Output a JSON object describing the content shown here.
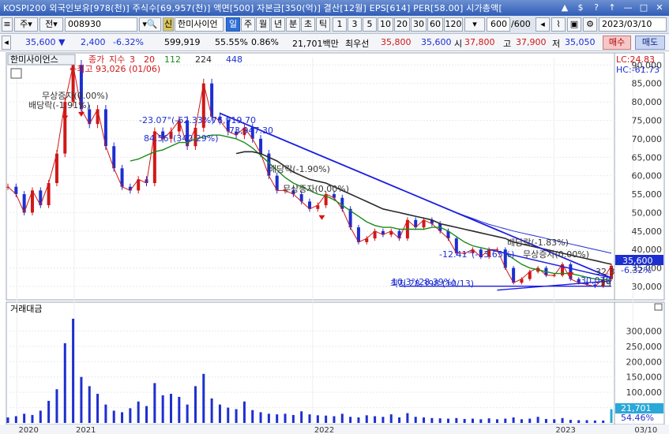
{
  "window": {
    "title": "KOSPI200 외국인보유[978(천)] 주식수[69,957(천)] 액면[500] 자본금[350(억)] 결산[12월] EPS[614] PER[58.00] 시가총액[",
    "buttons": [
      "▲",
      "$",
      "?",
      "↑",
      "—",
      "□",
      "✕"
    ]
  },
  "toolbar": {
    "period_select": "주",
    "prev_label": "전",
    "code": "008930",
    "name_badge": "신",
    "stock_name": "한미사이언",
    "tabs": [
      "일",
      "주",
      "월",
      "년",
      "분",
      "초",
      "틱"
    ],
    "intervals": [
      "1",
      "3",
      "5",
      "10",
      "20",
      "30",
      "60",
      "120"
    ],
    "count_value": "600",
    "count_total": "/600",
    "date": "2023/03/10"
  },
  "quote": {
    "price": "35,600",
    "change": "2,400",
    "change_pct": "-6.32%",
    "volume": "599,919",
    "ratio": "55.55%",
    "turnover": "0.86%",
    "amount": "21,701백만",
    "best_ask_label": "최우선",
    "best_ask": "35,800",
    "best_bid": "35,600",
    "open_label": "시",
    "open": "37,800",
    "high_label": "고",
    "high": "37,900",
    "low_label": "저",
    "low": "35,050",
    "buy_label": "매수",
    "sell_label": "매도"
  },
  "colors": {
    "price_line": "#d01818",
    "candle_up": "#d01818",
    "candle_down": "#1d2fd0",
    "ma20": "#1a8a1a",
    "ma112": "#2a2a2a",
    "ma224": "#1d2fd0",
    "trend_line": "#1d1de0"
  },
  "chart_data": [
    {
      "type": "line",
      "title": "한미사이언스",
      "legend": [
        "종가",
        "지수",
        "3",
        "20",
        "112",
        "224",
        "448"
      ],
      "lc_label": "LC:24.83",
      "hc_label": "HC:-61.73",
      "ylim": [
        27000,
        92000
      ],
      "y_ticks": [
        "90,000",
        "85,000",
        "80,000",
        "75,000",
        "70,000",
        "65,000",
        "60,000",
        "55,000",
        "50,000",
        "45,000",
        "40,000",
        "35,000",
        "30,000"
      ],
      "x_ticks": [
        "2020",
        "2021",
        "2022",
        "2023",
        "03/10"
      ],
      "current_price_tag": "35,600",
      "current_change_tag": "-6.32%",
      "annotations": [
        "←최고 93,026 (01/06)",
        "무상증자(0.00%)",
        "배당락(-1.91%)",
        "-23.07°(-62.33%)",
        "76,919.70",
        "73,947.30",
        "84.56°(340.29%)",
        "배당락(-1.90%)",
        "무상증자(0.00%)",
        "배당락(-1.83%)",
        "무상증자(0.00%)",
        "-12.41°(-13.65%)",
        "최저 28,398 (10/13)",
        "30,070",
        "32.3",
        "10.3°(28.39%)",
        "29"
      ],
      "x": [
        0,
        10,
        20,
        30,
        40,
        50,
        60,
        70,
        80,
        90,
        100,
        110,
        120,
        130,
        140,
        150,
        160,
        170,
        180,
        190,
        200,
        210,
        220,
        230,
        240,
        250,
        260,
        270,
        280,
        290,
        300,
        310,
        320,
        330,
        340,
        350,
        360,
        370,
        380,
        390,
        400,
        410,
        420,
        430,
        440,
        450,
        460,
        470,
        480,
        490,
        500,
        510,
        520,
        530,
        540,
        550,
        560,
        570,
        580,
        590,
        600,
        610,
        620,
        630,
        640,
        650,
        660,
        670,
        680,
        690,
        700,
        710,
        720,
        730,
        740
      ],
      "close": [
        57000,
        55000,
        50000,
        56000,
        52000,
        58000,
        66000,
        80000,
        90000,
        78000,
        74000,
        78000,
        68000,
        62000,
        57000,
        56000,
        59000,
        58000,
        72000,
        70000,
        72000,
        75000,
        68000,
        73000,
        85000,
        76000,
        75000,
        72000,
        71000,
        73000,
        70000,
        66000,
        60000,
        56000,
        56000,
        55000,
        53000,
        51000,
        52000,
        55000,
        54000,
        51000,
        46000,
        42000,
        43000,
        45000,
        44000,
        45000,
        43000,
        48000,
        46000,
        48000,
        47000,
        45000,
        43000,
        39000,
        39000,
        40000,
        38000,
        40000,
        40000,
        35000,
        31000,
        32000,
        34000,
        35000,
        33000,
        33000,
        36000,
        32000,
        31000,
        30500,
        30000,
        32000,
        35600
      ],
      "ma20": [
        null,
        null,
        null,
        null,
        null,
        null,
        null,
        null,
        null,
        null,
        null,
        null,
        null,
        null,
        null,
        64000,
        64500,
        65500,
        66500,
        67000,
        68000,
        69000,
        69000,
        70000,
        70500,
        71000,
        71000,
        70500,
        70000,
        69000,
        67500,
        65500,
        63500,
        61500,
        59500,
        58000,
        57000,
        56000,
        55000,
        54500,
        53500,
        52000,
        50500,
        49000,
        47500,
        46500,
        46000,
        46000,
        45500,
        45500,
        45500,
        45500,
        46000,
        46000,
        45000,
        43500,
        42000,
        41000,
        40500,
        40000,
        39500,
        39000,
        37500,
        36000,
        35000,
        34500,
        34000,
        33500,
        33500,
        33500,
        33000,
        32500,
        32000,
        31800,
        32000
      ],
      "ma112": [
        null,
        null,
        null,
        null,
        null,
        null,
        null,
        null,
        null,
        null,
        null,
        null,
        null,
        null,
        null,
        null,
        null,
        null,
        null,
        null,
        null,
        null,
        null,
        null,
        null,
        null,
        null,
        null,
        66000,
        66500,
        66500,
        66000,
        65000,
        64000,
        62500,
        61000,
        60000,
        59000,
        58500,
        58000,
        57000,
        56000,
        55000,
        54000,
        53000,
        52000,
        51000,
        50500,
        50000,
        49500,
        49000,
        48500,
        48000,
        47000,
        46500,
        46000,
        45500,
        45000,
        44500,
        44000,
        43500,
        43000,
        42000,
        41500,
        41000,
        40500,
        40000,
        39500,
        39000,
        38500,
        38000,
        37500,
        37000,
        36500,
        36000
      ],
      "ma224": [
        null,
        null,
        null,
        null,
        null,
        null,
        null,
        null,
        null,
        null,
        null,
        null,
        null,
        null,
        null,
        null,
        null,
        null,
        null,
        null,
        null,
        null,
        null,
        null,
        null,
        null,
        null,
        null,
        null,
        null,
        null,
        null,
        null,
        null,
        null,
        null,
        null,
        null,
        null,
        null,
        null,
        null,
        null,
        null,
        null,
        null,
        null,
        null,
        null,
        null,
        null,
        null,
        null,
        null,
        null,
        50000,
        49200,
        48400,
        47600,
        46800,
        46200,
        45600,
        45000,
        44500,
        44000,
        43500,
        43000,
        42500,
        42000,
        41500,
        41000,
        40500,
        40000,
        39500,
        39000
      ]
    },
    {
      "type": "bar",
      "title": "거래대금",
      "ylim": [
        0,
        350000
      ],
      "y_ticks": [
        "300,000",
        "250,000",
        "200,000",
        "150,000",
        "100,000",
        "50,000"
      ],
      "current_value_tag": "21,701",
      "current_pct_tag": "54.46%",
      "x": [
        0,
        10,
        20,
        30,
        40,
        50,
        60,
        70,
        80,
        90,
        100,
        110,
        120,
        130,
        140,
        150,
        160,
        170,
        180,
        190,
        200,
        210,
        220,
        230,
        240,
        250,
        260,
        270,
        280,
        290,
        300,
        310,
        320,
        330,
        340,
        350,
        360,
        370,
        380,
        390,
        400,
        410,
        420,
        430,
        440,
        450,
        460,
        470,
        480,
        490,
        500,
        510,
        520,
        530,
        540,
        550,
        560,
        570,
        580,
        590,
        600,
        610,
        620,
        630,
        640,
        650,
        660,
        670,
        680,
        690,
        700,
        710,
        720,
        730,
        740
      ],
      "values": [
        18000,
        22000,
        30000,
        26000,
        40000,
        72000,
        110000,
        260000,
        340000,
        150000,
        120000,
        95000,
        60000,
        40000,
        35000,
        48000,
        70000,
        55000,
        130000,
        90000,
        95000,
        85000,
        60000,
        120000,
        160000,
        80000,
        60000,
        50000,
        45000,
        70000,
        42000,
        35000,
        30000,
        28000,
        30000,
        26000,
        38000,
        28000,
        25000,
        24000,
        22000,
        30000,
        20000,
        18000,
        25000,
        22000,
        20000,
        28000,
        18000,
        32000,
        20000,
        18000,
        16000,
        15000,
        14000,
        16000,
        13000,
        14000,
        12000,
        15000,
        12000,
        14000,
        18000,
        12000,
        14000,
        20000,
        13000,
        12000,
        16000,
        10000,
        9000,
        9000,
        8000,
        8000,
        45000
      ]
    }
  ]
}
